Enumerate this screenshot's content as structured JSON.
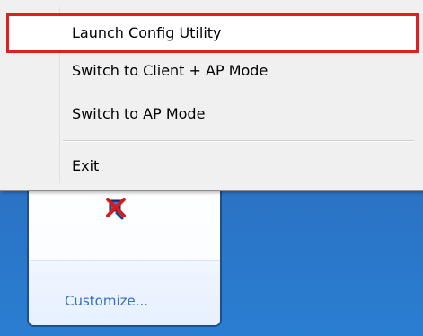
{
  "context_menu": {
    "items": [
      {
        "label": "Launch Config Utility"
      },
      {
        "label": "Switch to Client + AP Mode"
      },
      {
        "label": "Switch to AP Mode"
      },
      {
        "label": "Exit"
      }
    ]
  },
  "tray_popup": {
    "customize_label": "Customize...",
    "icon_name": "network-disabled-icon"
  },
  "colors": {
    "highlight_border": "#e02020",
    "desktop_blue": "#2a7ed2",
    "link_blue": "#2f6fc4"
  }
}
